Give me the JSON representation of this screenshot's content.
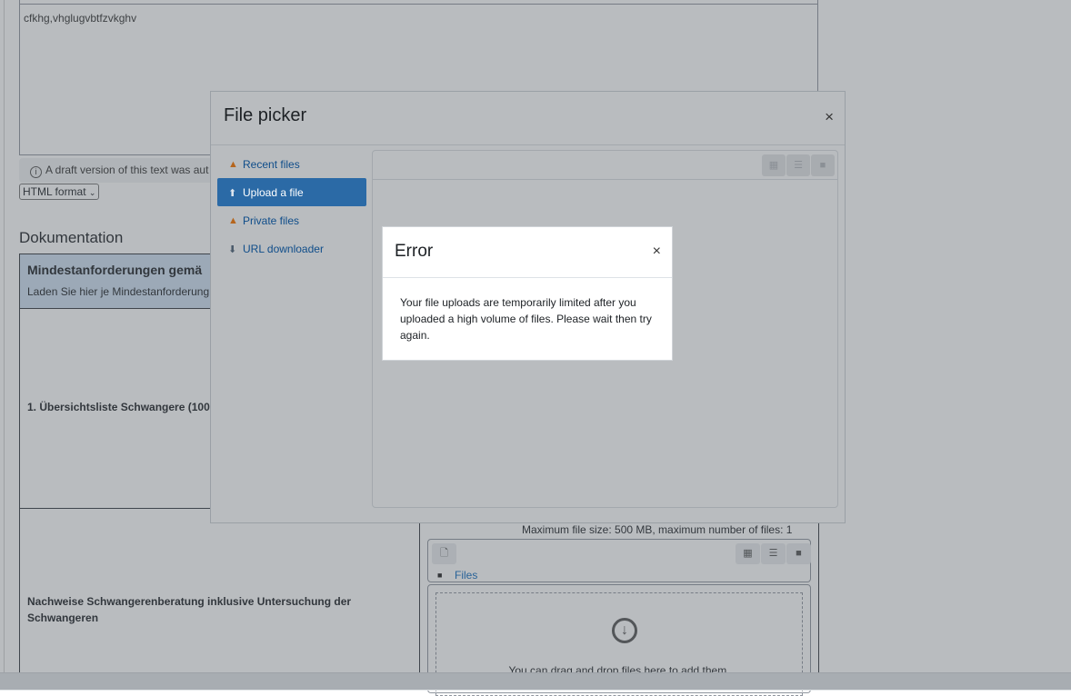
{
  "editor": {
    "text": "cfkhg,vhglugvbtfzvkghv"
  },
  "draft_note": {
    "text": "A draft version of this text was aut"
  },
  "format_select": {
    "value": "HTML format"
  },
  "section": {
    "title": "Dokumentation"
  },
  "doc_table": {
    "header_title": "Mindestanforderungen gemä",
    "header_sub": "Laden Sie hier je Mindestanforderung",
    "row1_label": "1. Übersichtsliste Schwangere (100",
    "row2_label": "Nachweise Schwangerenberatung inklusive Untersuchung der Schwangeren"
  },
  "filemanager": {
    "max_size": "Maximum file size: 500 MB, maximum number of files: 1",
    "files_link": "Files",
    "drop_text": "You can drag and drop files here to add them."
  },
  "file_picker": {
    "title": "File picker",
    "close": "×",
    "nav": [
      {
        "label": "Recent files",
        "icon": "recent-files-icon"
      },
      {
        "label": "Upload a file",
        "icon": "upload-icon",
        "active": true
      },
      {
        "label": "Private files",
        "icon": "private-files-icon"
      },
      {
        "label": "URL downloader",
        "icon": "url-downloader-icon"
      }
    ]
  },
  "error_dialog": {
    "title": "Error",
    "close": "×",
    "message": "Your file uploads are temporarily limited after you uploaded a high volume of files. Please wait then try again."
  },
  "colors": {
    "accent": "#2b6aa6",
    "link": "#0f6cbf",
    "table_header": "#cfe0f2"
  }
}
